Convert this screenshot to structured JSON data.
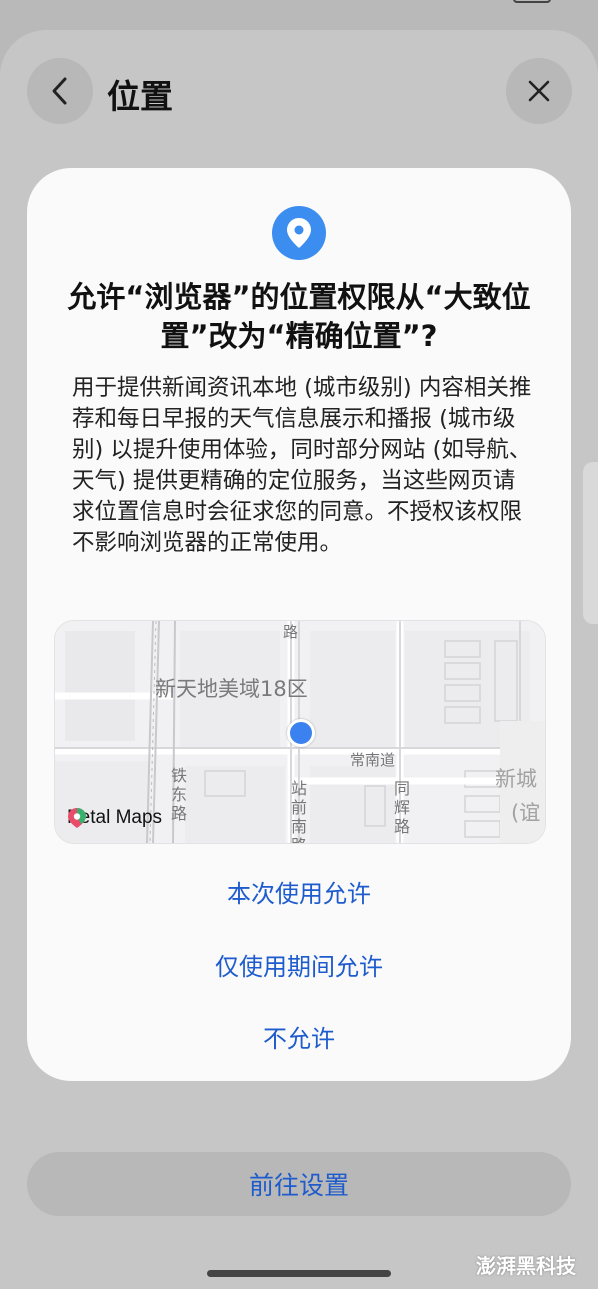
{
  "header": {
    "title": "位置",
    "back_icon": "chevron-left-icon",
    "close_icon": "close-icon"
  },
  "dialog": {
    "icon": "location-pin-icon",
    "title": "允许“浏览器”的位置权限从“大致位置”改为“精确位置”?",
    "body": "用于提供新闻资讯本地 (城市级别) 内容相关推荐和每日早报的天气信息展示和播报 (城市级别) 以提升使用体验，同时部分网站 (如导航、天气) 提供更精确的定位服务，当这些网页请求位置信息时会征求您的同意。不授权该权限不影响浏览器的正常使用。",
    "map": {
      "labels": {
        "area": "新天地美域18区",
        "road_top": "路",
        "road_east": "常南道",
        "tie_dong_lu": "铁东路",
        "zhan_qian_nan_lu": "站前南路",
        "tong_hui_lu": "同辉路",
        "xincheng": "新城",
        "yi": "(谊"
      },
      "attribution": "Petal Maps"
    },
    "options": {
      "allow_once": "本次使用允许",
      "allow_while_using": "仅使用期间允许",
      "deny": "不允许"
    }
  },
  "footer": {
    "settings_button": "前往设置"
  },
  "watermark": "澎湃黑科技",
  "colors": {
    "accent": "#1e5bcc",
    "pin": "#3b8df0",
    "dialog_bg": "#fafafa"
  }
}
